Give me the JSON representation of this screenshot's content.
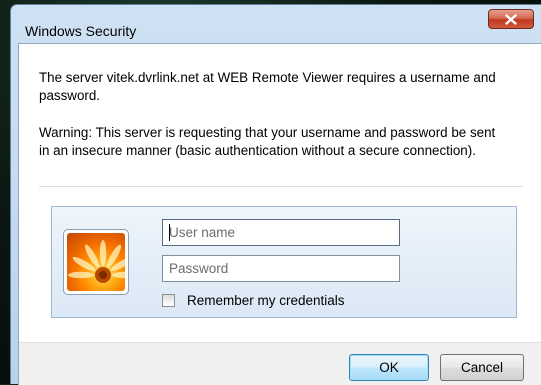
{
  "dialog": {
    "title": "Windows Security",
    "close_icon": "close-icon",
    "message": "The server vitek.dvrlink.net at WEB Remote Viewer requires a username and password.",
    "warning": "Warning: This server is requesting that your username and password be sent in an insecure manner (basic authentication without a secure connection).",
    "username_placeholder": "User name",
    "username_value": "",
    "password_placeholder": "Password",
    "password_value": "",
    "remember_label": "Remember my credentials",
    "remember_checked": false,
    "ok_label": "OK",
    "cancel_label": "Cancel",
    "avatar_icon": "user-flower-avatar-icon"
  },
  "colors": {
    "titlebar": "#c4dbf0",
    "close_button": "#c94a2f",
    "ok_button_border": "#3c7fb1",
    "footer": "#f0f0f0"
  }
}
